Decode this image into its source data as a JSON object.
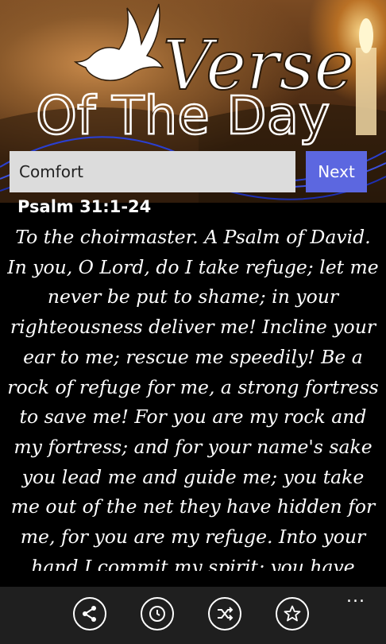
{
  "banner": {
    "title_word": "Verse",
    "subtitle": "Of The Day"
  },
  "search": {
    "value": "Comfort",
    "button_label": "Next"
  },
  "verse": {
    "reference": "Psalm 31:1-24",
    "text": "To the choirmaster. A Psalm of David. In you, O Lord, do I take refuge; let me never be put to shame; in your righteousness deliver me! Incline your ear to me; rescue me speedily! Be a rock of refuge for me, a strong fortress to save me! For you are my rock and my fortress; and for your name's sake you lead me and guide me; you take me out of the net they have hidden for me, for you are my refuge. Into your hand I commit my spirit; you have"
  },
  "appbar": {
    "buttons": [
      "share-icon",
      "clock-icon",
      "shuffle-icon",
      "star-icon"
    ],
    "more": "..."
  },
  "colors": {
    "accent": "#5c67e0",
    "appbar_bg": "#1f1f1f"
  }
}
